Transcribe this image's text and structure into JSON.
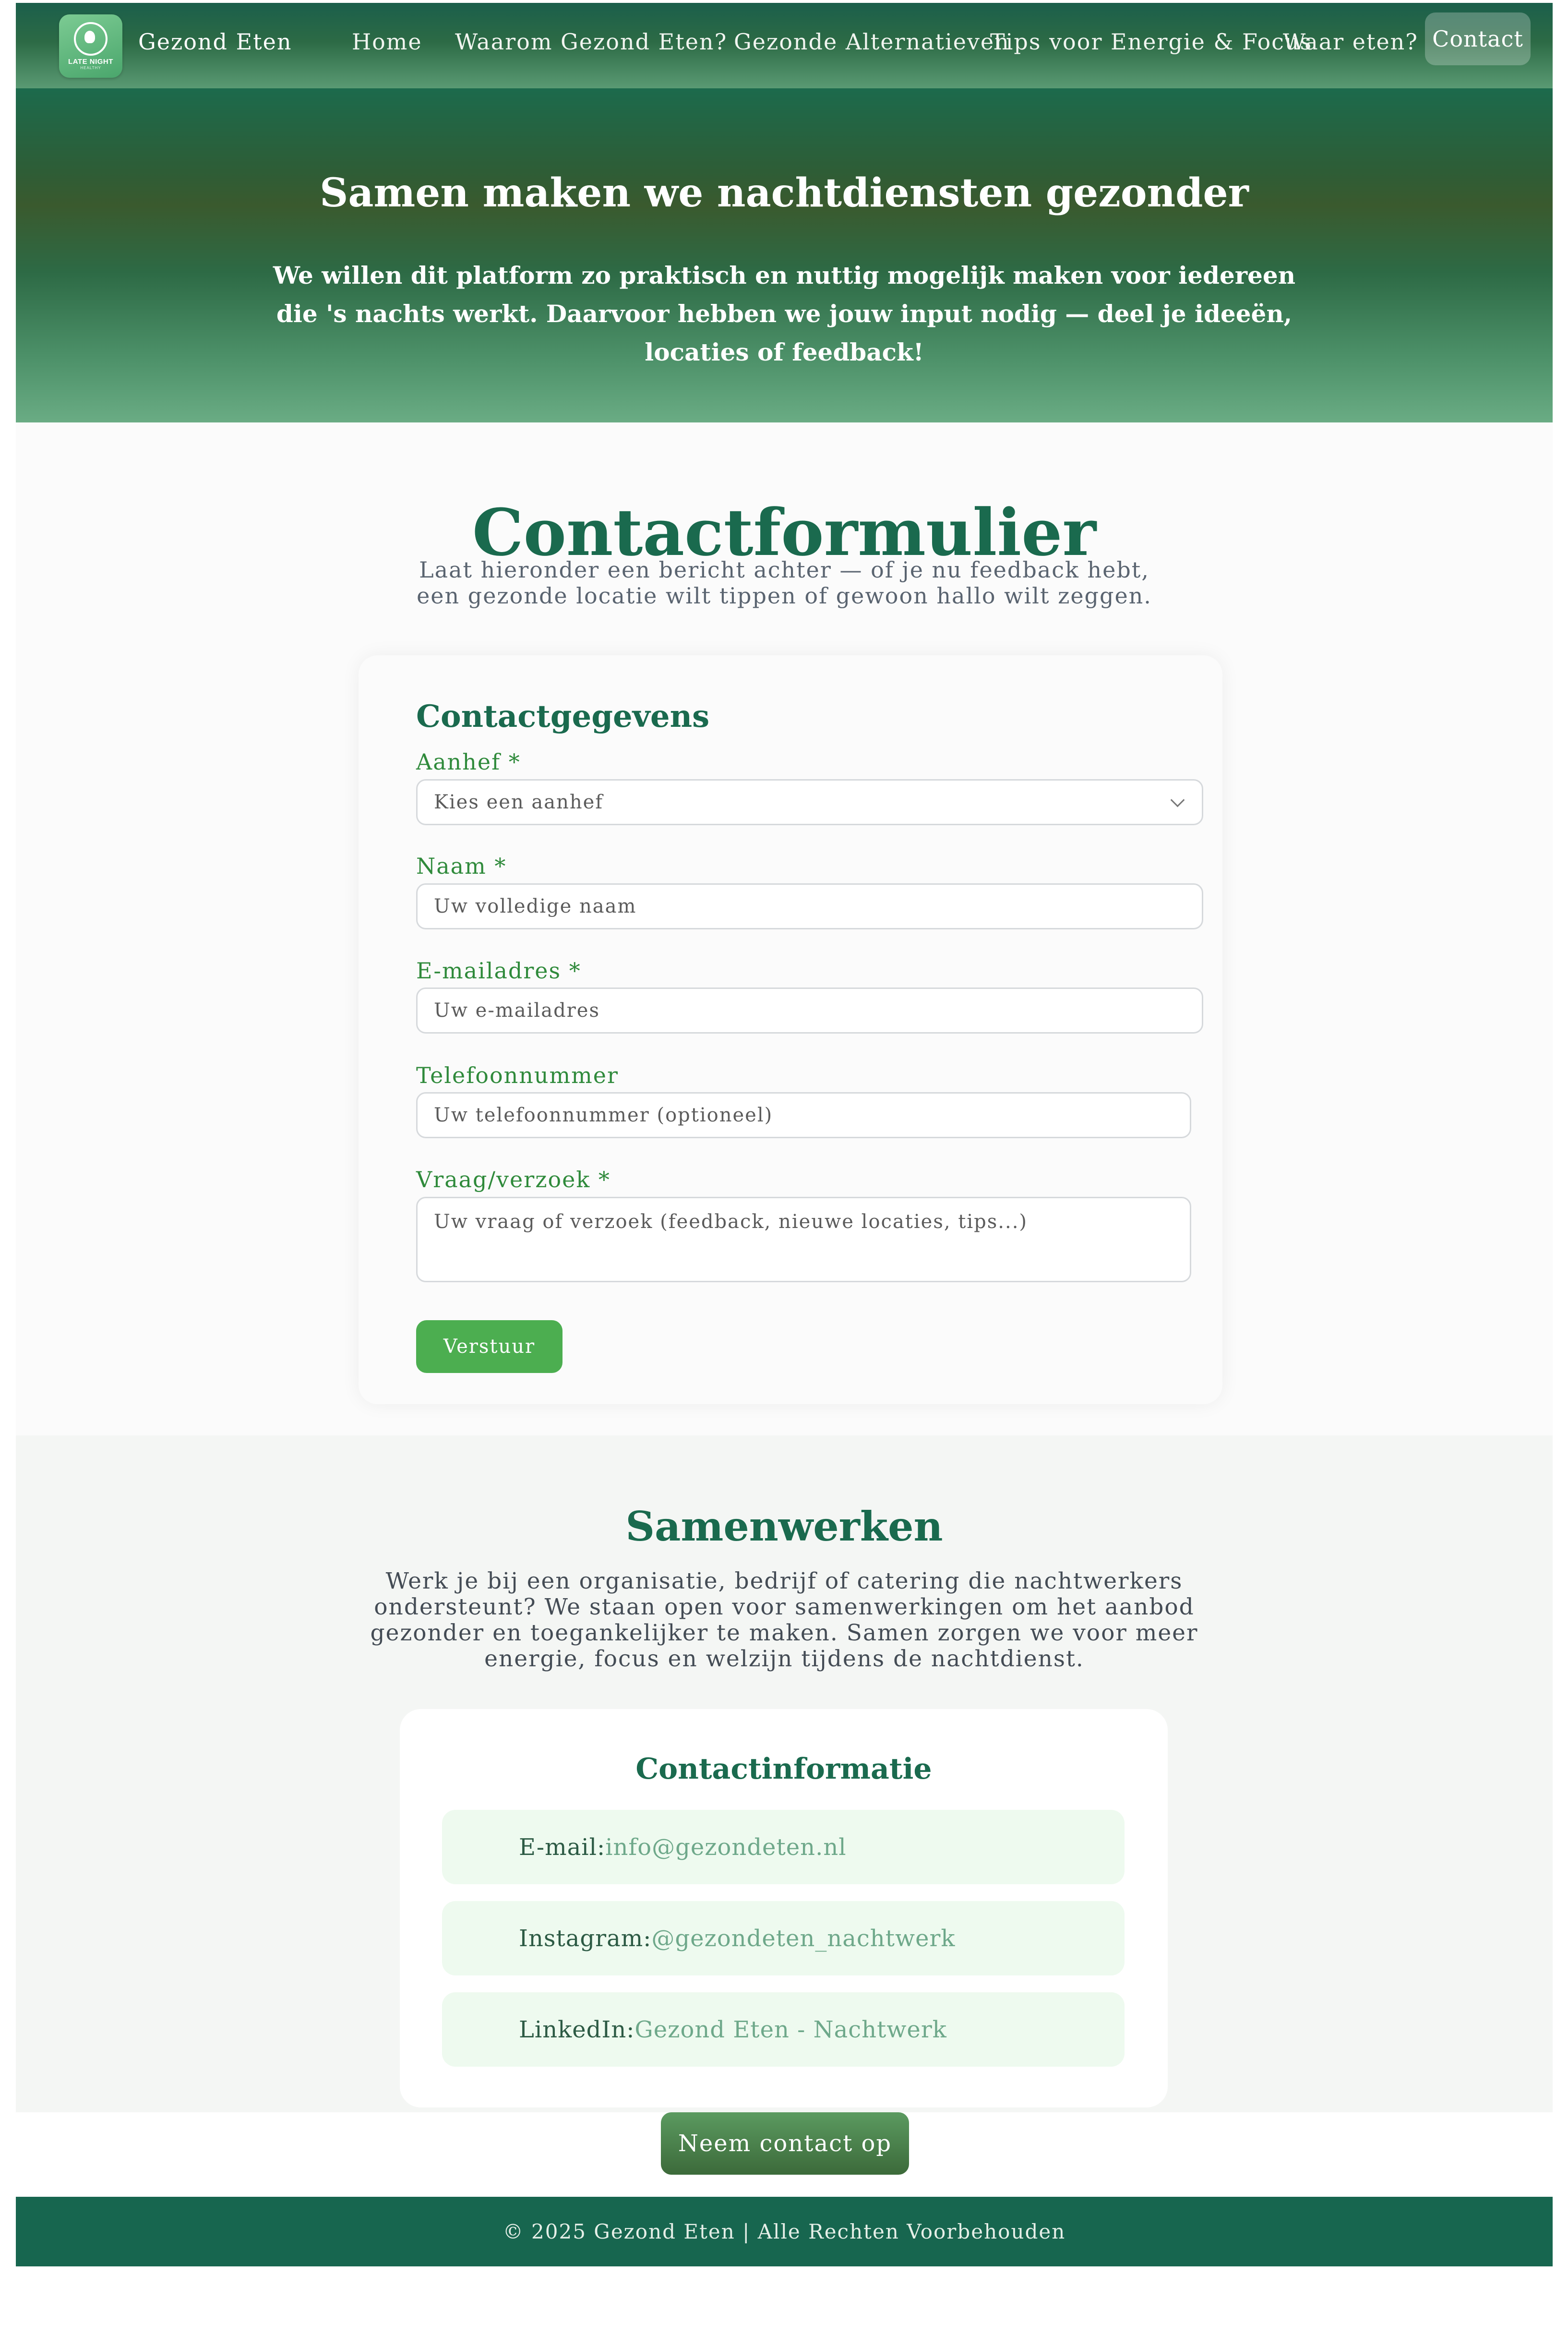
{
  "nav": {
    "logo_line1": "LATE NIGHT",
    "logo_line2": "HEALTHY",
    "brand": "Gezond Eten",
    "links": [
      "Home",
      "Waarom Gezond Eten?",
      "Gezonde Alternatieven",
      "Tips voor Energie & Focus",
      "Waar eten?"
    ],
    "contact": "Contact"
  },
  "hero": {
    "title": "Samen maken we nachtdiensten gezonder",
    "text": "We willen dit platform zo praktisch en nuttig mogelijk maken voor iedereen die 's nachts werkt. Daarvoor hebben we jouw input nodig — deel je ideeën, locaties of feedback!"
  },
  "contact": {
    "title": "Contactformulier",
    "intro": "Laat hieronder een bericht achter — of je nu feedback hebt, een gezonde locatie wilt tippen of gewoon hallo wilt zeggen.",
    "form": {
      "heading": "Contactgegevens",
      "salutation_label": "Aanhef *",
      "salutation_value": "Kies een aanhef",
      "name_label": "Naam *",
      "name_placeholder": "Uw volledige naam",
      "email_label": "E-mailadres *",
      "email_placeholder": "Uw e-mailadres",
      "phone_label": "Telefoonnummer",
      "phone_placeholder": "Uw telefoonnummer (optioneel)",
      "question_label": "Vraag/verzoek *",
      "question_placeholder": "Uw vraag of verzoek (feedback, nieuwe locaties, tips...)",
      "submit": "Verstuur"
    }
  },
  "collab": {
    "title": "Samenwerken",
    "text": "Werk je bij een organisatie, bedrijf of catering die nachtwerkers ondersteunt? We staan open voor samenwerkingen om het aanbod gezonder en toegankelijker te maken. Samen zorgen we voor meer energie, focus en welzijn tijdens de nachtdienst.",
    "info": {
      "title": "Contactinformatie",
      "rows": [
        {
          "label": "E-mail:",
          "value": "info@gezondeten.nl"
        },
        {
          "label": "Instagram:",
          "value": "@gezondeten_nachtwerk"
        },
        {
          "label": "LinkedIn:",
          "value": "Gezond Eten - Nachtwerk"
        }
      ]
    },
    "cta": "Neem contact op"
  },
  "footer": {
    "text": "© 2025 Gezond Eten | Alle Rechten Voorbehouden"
  },
  "colors": {
    "primary": "#1a6a4e",
    "accent": "#4cae50",
    "footer": "#17664f"
  }
}
